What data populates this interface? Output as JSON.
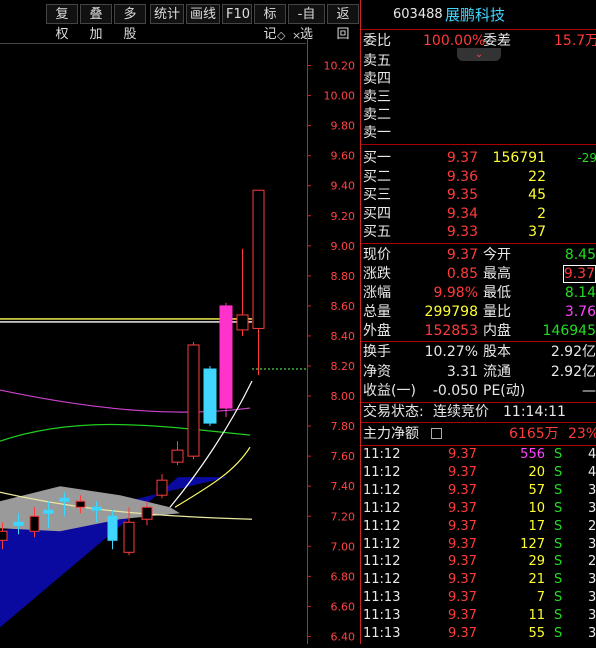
{
  "toolbar": {
    "buttons": [
      "复权",
      "叠加",
      "多股",
      "统计",
      "画线",
      "F10",
      "标记",
      "-自选",
      "返回"
    ]
  },
  "header": {
    "code": "603488",
    "name": "展鹏科技"
  },
  "price_axis": {
    "ticks": [
      "10.20",
      "10.00",
      "9.80",
      "9.60",
      "9.40",
      "9.20",
      "9.00",
      "8.80",
      "8.60",
      "8.40",
      "8.20",
      "8.00",
      "7.80",
      "7.60",
      "7.40",
      "7.20",
      "7.00",
      "6.80",
      "6.60",
      "6.40"
    ]
  },
  "ratio": {
    "label1": "委比",
    "value1": "100.00%",
    "label2": "委差",
    "value2": "15.7万"
  },
  "sell": [
    {
      "label": "卖五"
    },
    {
      "label": "卖四"
    },
    {
      "label": "卖三"
    },
    {
      "label": "卖二"
    },
    {
      "label": "卖一"
    }
  ],
  "buy": [
    {
      "label": "买一",
      "price": "9.37",
      "vol": "156791",
      "chg": "-29"
    },
    {
      "label": "买二",
      "price": "9.36",
      "vol": "22",
      "chg": ""
    },
    {
      "label": "买三",
      "price": "9.35",
      "vol": "45",
      "chg": ""
    },
    {
      "label": "买四",
      "price": "9.34",
      "vol": "2",
      "chg": ""
    },
    {
      "label": "买五",
      "price": "9.33",
      "vol": "37",
      "chg": ""
    }
  ],
  "quote": [
    {
      "l1": "现价",
      "v1": "9.37",
      "l2": "今开",
      "v2": "8.45"
    },
    {
      "l1": "涨跌",
      "v1": "0.85",
      "l2": "最高",
      "v2": "9.37"
    },
    {
      "l1": "涨幅",
      "v1": "9.98%",
      "l2": "最低",
      "v2": "8.14"
    },
    {
      "l1": "总量",
      "v1": "299798",
      "l2": "量比",
      "v2": "3.76"
    },
    {
      "l1": "外盘",
      "v1": "152853",
      "l2": "内盘",
      "v2": "146945"
    }
  ],
  "stats": [
    {
      "l1": "换手",
      "v1": "10.27%",
      "l2": "股本",
      "v2": "2.92亿"
    },
    {
      "l1": "净资",
      "v1": "3.31",
      "l2": "流通",
      "v2": "2.92亿"
    },
    {
      "l1": "收益(一)",
      "v1": "-0.050",
      "l2": "PE(动)",
      "v2": "—"
    }
  ],
  "status": {
    "label": "交易状态:",
    "value": "连续竞价",
    "time": "11:14:11"
  },
  "mainforce": {
    "label": "主力净额",
    "value": "6165万",
    "pct": "23%"
  },
  "ticks": [
    {
      "time": "11:12",
      "price": "9.37",
      "vol": "556",
      "side": "S",
      "n": "4"
    },
    {
      "time": "11:12",
      "price": "9.37",
      "vol": "20",
      "side": "S",
      "n": "4"
    },
    {
      "time": "11:12",
      "price": "9.37",
      "vol": "57",
      "side": "S",
      "n": "3"
    },
    {
      "time": "11:12",
      "price": "9.37",
      "vol": "10",
      "side": "S",
      "n": "3"
    },
    {
      "time": "11:12",
      "price": "9.37",
      "vol": "17",
      "side": "S",
      "n": "2"
    },
    {
      "time": "11:12",
      "price": "9.37",
      "vol": "127",
      "side": "S",
      "n": "3"
    },
    {
      "time": "11:12",
      "price": "9.37",
      "vol": "29",
      "side": "S",
      "n": "2"
    },
    {
      "time": "11:12",
      "price": "9.37",
      "vol": "21",
      "side": "S",
      "n": "3"
    },
    {
      "time": "11:13",
      "price": "9.37",
      "vol": "7",
      "side": "S",
      "n": "3"
    },
    {
      "time": "11:13",
      "price": "9.37",
      "vol": "11",
      "side": "S",
      "n": "3"
    },
    {
      "time": "11:13",
      "price": "9.37",
      "vol": "55",
      "side": "S",
      "n": "3"
    }
  ],
  "colors": {
    "up": "#ff3b3b",
    "down": "#3fd6ff",
    "accent": "#ff33cc"
  },
  "chart_data": {
    "type": "candlestick",
    "ylim": [
      6.4,
      10.3
    ],
    "candles": [
      {
        "o": 7.04,
        "c": 7.1,
        "h": 7.16,
        "l": 6.98,
        "up": true
      },
      {
        "o": 7.14,
        "c": 7.16,
        "h": 7.22,
        "l": 7.08,
        "up": false
      },
      {
        "o": 7.1,
        "c": 7.2,
        "h": 7.26,
        "l": 7.06,
        "up": true
      },
      {
        "o": 7.22,
        "c": 7.24,
        "h": 7.3,
        "l": 7.12,
        "up": false
      },
      {
        "o": 7.3,
        "c": 7.32,
        "h": 7.36,
        "l": 7.2,
        "up": false
      },
      {
        "o": 7.26,
        "c": 7.3,
        "h": 7.34,
        "l": 7.22,
        "up": true
      },
      {
        "o": 7.26,
        "c": 7.24,
        "h": 7.3,
        "l": 7.16,
        "up": false
      },
      {
        "o": 7.2,
        "c": 7.04,
        "h": 7.24,
        "l": 6.98,
        "up": false
      },
      {
        "o": 6.96,
        "c": 7.16,
        "h": 7.26,
        "l": 6.94,
        "up": true
      },
      {
        "o": 7.18,
        "c": 7.26,
        "h": 7.3,
        "l": 7.14,
        "up": true
      },
      {
        "o": 7.34,
        "c": 7.44,
        "h": 7.48,
        "l": 7.32,
        "up": true
      },
      {
        "o": 7.56,
        "c": 7.64,
        "h": 7.7,
        "l": 7.54,
        "up": true
      },
      {
        "o": 7.6,
        "c": 8.34,
        "h": 8.36,
        "l": 7.58,
        "up": true
      },
      {
        "o": 8.18,
        "c": 7.82,
        "h": 8.2,
        "l": 7.8,
        "up": false
      },
      {
        "o": 8.6,
        "c": 7.92,
        "h": 8.62,
        "l": 7.86,
        "up": false
      },
      {
        "o": 8.44,
        "c": 8.54,
        "h": 8.98,
        "l": 8.4,
        "up": true
      },
      {
        "o": 8.45,
        "c": 9.37,
        "h": 9.37,
        "l": 8.14,
        "up": true
      }
    ],
    "lines": {
      "price_level": 8.5,
      "dashed_level": 8.18
    }
  }
}
